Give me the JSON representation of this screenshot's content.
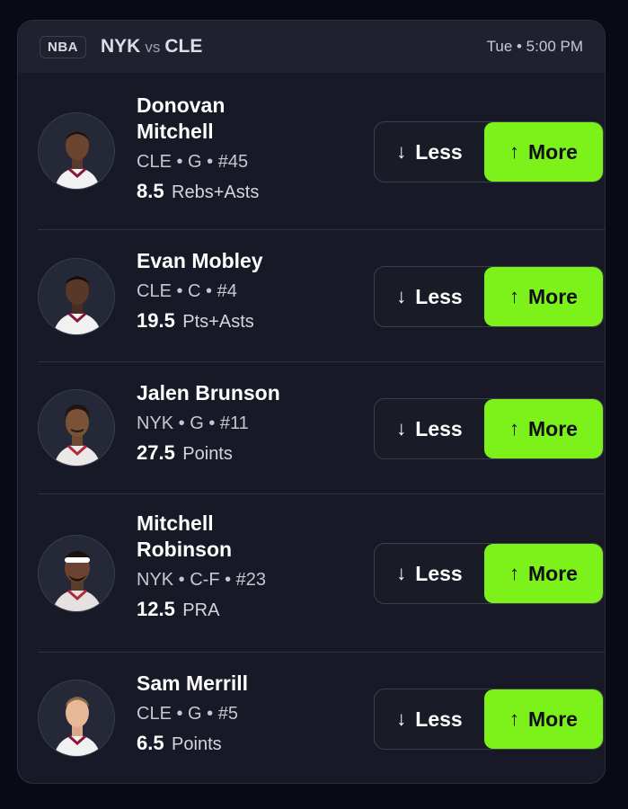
{
  "header": {
    "league": "NBA",
    "team_away": "NYK",
    "vs": "vs",
    "team_home": "CLE",
    "time": "Tue • 5:00 PM"
  },
  "buttons": {
    "less_label": "Less",
    "more_label": "More",
    "less_icon": "arrow-down-icon",
    "more_icon": "arrow-up-icon"
  },
  "colors": {
    "accent": "#7cf21a",
    "card": "#171a26",
    "background": "#090b14"
  },
  "players": [
    {
      "name": "Donovan Mitchell",
      "meta": "CLE • G • #45",
      "line": "8.5",
      "stat": "Rebs+Asts",
      "jersey": "cle"
    },
    {
      "name": "Evan Mobley",
      "meta": "CLE • C • #4",
      "line": "19.5",
      "stat": "Pts+Asts",
      "jersey": "cle"
    },
    {
      "name": "Jalen Brunson",
      "meta": "NYK • G • #11",
      "line": "27.5",
      "stat": "Points",
      "jersey": "nyk"
    },
    {
      "name": "Mitchell Robinson",
      "meta": "NYK • C-F • #23",
      "line": "12.5",
      "stat": "PRA",
      "jersey": "nyk"
    },
    {
      "name": "Sam Merrill",
      "meta": "CLE • G • #5",
      "line": "6.5",
      "stat": "Points",
      "jersey": "cle"
    }
  ]
}
